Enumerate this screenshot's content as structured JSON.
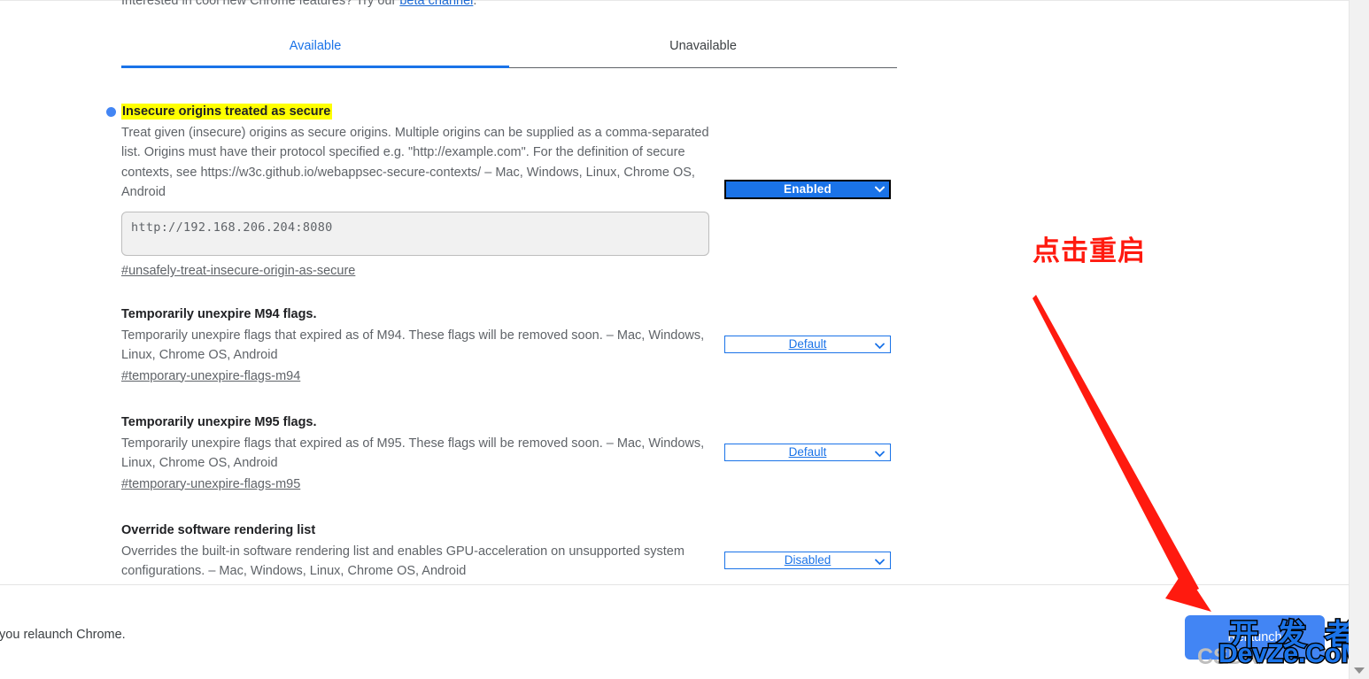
{
  "beta_notice": {
    "prefix": "Interested in cool new Chrome features? Try our ",
    "link_label": "beta channel",
    "suffix": "."
  },
  "tabs": [
    {
      "label": "Available",
      "selected": true
    },
    {
      "label": "Unavailable",
      "selected": false
    }
  ],
  "experiments": [
    {
      "title": "Insecure origins treated as secure",
      "highlighted": true,
      "description": "Treat given (insecure) origins as secure origins. Multiple origins can be supplied as a comma-separated list. Origins must have their protocol specified e.g. \"http://example.com\". For the definition of secure contexts, see https://w3c.github.io/webappsec-secure-contexts/ – Mac, Windows, Linux, Chrome OS, Android",
      "textarea_value": "http://192.168.206.204:8080",
      "permalink": "#unsafely-treat-insecure-origin-as-secure",
      "select_value": "Enabled",
      "select_state": "enabled-focused"
    },
    {
      "title": "Temporarily unexpire M94 flags.",
      "highlighted": false,
      "description": "Temporarily unexpire flags that expired as of M94. These flags will be removed soon. – Mac, Windows, Linux, Chrome OS, Android",
      "permalink": "#temporary-unexpire-flags-m94",
      "select_value": "Default",
      "select_state": "default"
    },
    {
      "title": "Temporarily unexpire M95 flags.",
      "highlighted": false,
      "description": "Temporarily unexpire flags that expired as of M95. These flags will be removed soon. – Mac, Windows, Linux, Chrome OS, Android",
      "permalink": "#temporary-unexpire-flags-m95",
      "select_value": "Default",
      "select_state": "default"
    },
    {
      "title": "Override software rendering list",
      "highlighted": false,
      "description": "Overrides the built-in software rendering list and enables GPU-acceleration on unsupported system configurations. – Mac, Windows, Linux, Chrome OS, Android",
      "permalink": "",
      "select_value": "Disabled",
      "select_state": "default"
    }
  ],
  "footer": {
    "note": "Your changes will take effect the next time you relaunch Chrome.",
    "relaunch_label": "Relaunch"
  },
  "annotation": {
    "text": "点击重启",
    "color": "#ff1a0f"
  },
  "watermark": {
    "csdn": "CSDN",
    "chinese": "开 发 者",
    "domain": "DevZe.CoM"
  },
  "colors": {
    "accent_blue": "#1a73e8",
    "button_blue": "#4285f4",
    "highlight_yellow": "#ffff00",
    "annotation_red": "#ff1a0f",
    "muted_text": "#5f6368",
    "title_text": "#202124"
  }
}
